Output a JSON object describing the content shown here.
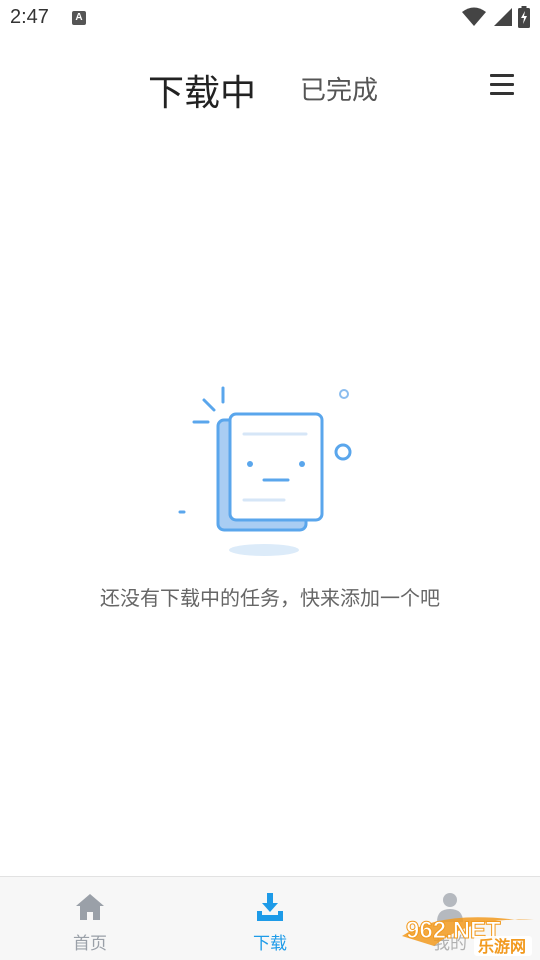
{
  "status_bar": {
    "time": "2:47",
    "notification_badge": "A",
    "icons": [
      "wifi-icon",
      "signal-icon",
      "battery-icon"
    ]
  },
  "top_tabs": {
    "active": "下载中",
    "inactive": "已完成"
  },
  "empty_state": {
    "message": "还没有下载中的任务，快来添加一个吧"
  },
  "bottom_nav": {
    "items": [
      {
        "label": "首页",
        "icon": "home-icon"
      },
      {
        "label": "下载",
        "icon": "download-icon",
        "active": true
      },
      {
        "label": "我的",
        "icon": "user-icon"
      }
    ]
  },
  "watermark": {
    "brand_top": "962.NET",
    "brand_bottom": "乐游网"
  },
  "colors": {
    "accent": "#1e9be8",
    "illustration_blue": "#5aa6ec",
    "illustration_light": "#a9cdf3",
    "watermark_orange": "#f29a1f"
  }
}
